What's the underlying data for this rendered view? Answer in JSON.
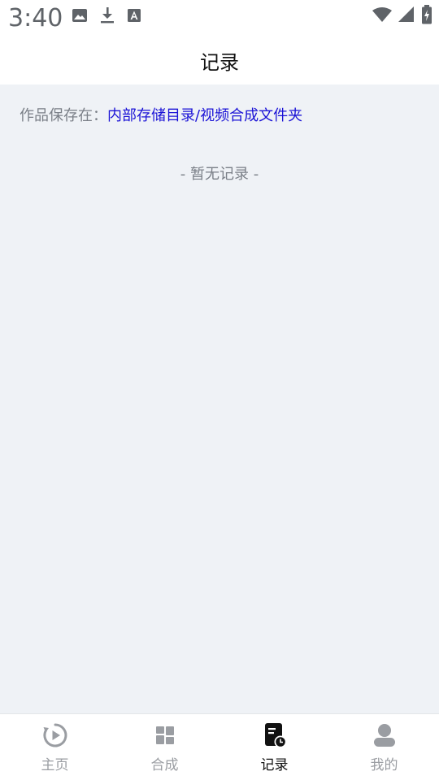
{
  "status_bar": {
    "time": "3:40",
    "left_icons": [
      "image-icon",
      "download-icon",
      "font-icon"
    ],
    "right_icons": [
      "wifi-icon",
      "signal-icon",
      "battery-icon"
    ]
  },
  "header": {
    "title": "记录"
  },
  "main": {
    "save_label": "作品保存在：",
    "save_path": "内部存储目录/视频合成文件夹",
    "empty_text": "- 暂无记录 -"
  },
  "bottom_nav": {
    "items": [
      {
        "label": "主页",
        "icon": "play-circle-icon",
        "active": false
      },
      {
        "label": "合成",
        "icon": "grid-icon",
        "active": false
      },
      {
        "label": "记录",
        "icon": "record-icon",
        "active": true
      },
      {
        "label": "我的",
        "icon": "user-icon",
        "active": false
      }
    ]
  },
  "colors": {
    "link": "#1a12d6",
    "content_bg": "#eff2f6",
    "active": "#111111",
    "inactive": "#9a9da2"
  }
}
